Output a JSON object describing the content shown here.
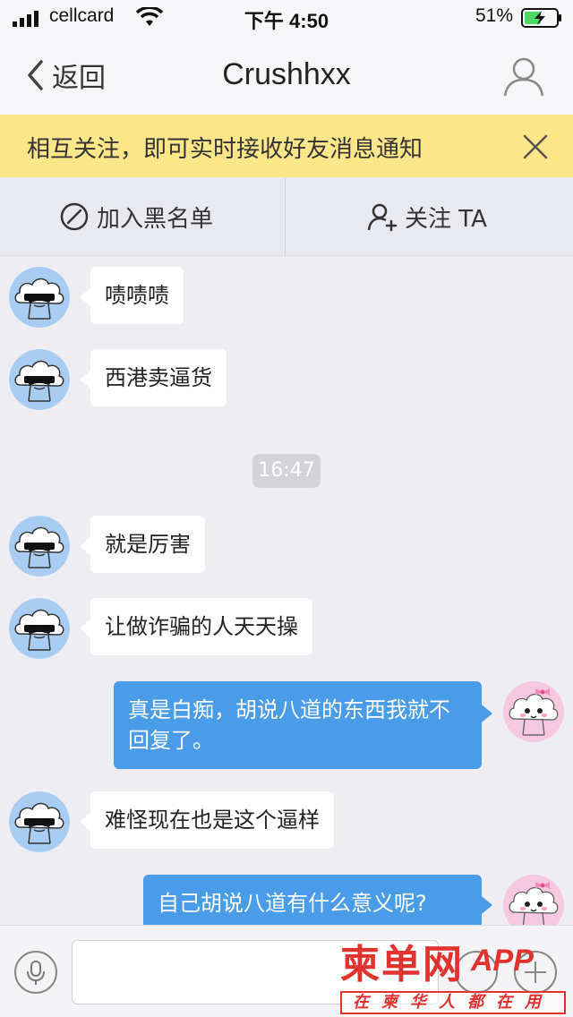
{
  "status_bar": {
    "carrier": "cellcard",
    "time": "下午 4:50",
    "battery_percent": "51%",
    "battery_level": 0.51,
    "signal_icon": "signal-bars-icon",
    "wifi_icon": "wifi-icon"
  },
  "nav": {
    "back_label": "返回",
    "title": "Crushhxx",
    "profile_icon": "person-icon"
  },
  "notice": {
    "text": "相互关注，即可实时接收好友消息通知",
    "close_icon": "close-icon"
  },
  "actions": {
    "block_label": "加入黑名单",
    "follow_label": "关注 TA"
  },
  "messages": [
    {
      "side": "in",
      "text": "啧啧啧"
    },
    {
      "side": "in",
      "text": "西港卖逼货"
    },
    {
      "side": "time",
      "text": "16:47"
    },
    {
      "side": "in",
      "text": "就是厉害"
    },
    {
      "side": "in",
      "text": "让做诈骗的人天天操"
    },
    {
      "side": "out",
      "text": "真是白痴，胡说八道的东西我就不回复了。"
    },
    {
      "side": "in",
      "text": "难怪现在也是这个逼样"
    },
    {
      "side": "out",
      "text": "自己胡说八道有什么意义呢?"
    }
  ],
  "input": {
    "value": "",
    "placeholder": "",
    "mic_icon": "microphone-icon",
    "emoji_icon": "emoji-icon",
    "plus_icon": "plus-icon"
  },
  "watermark": {
    "logo": "柬单网",
    "app": "APP",
    "tagline": "在柬华人都在用"
  },
  "colors": {
    "outgoing_bubble": "#4a9be8",
    "incoming_bubble": "#ffffff",
    "notice_background": "#fce68a",
    "chat_background": "#ededf2"
  }
}
